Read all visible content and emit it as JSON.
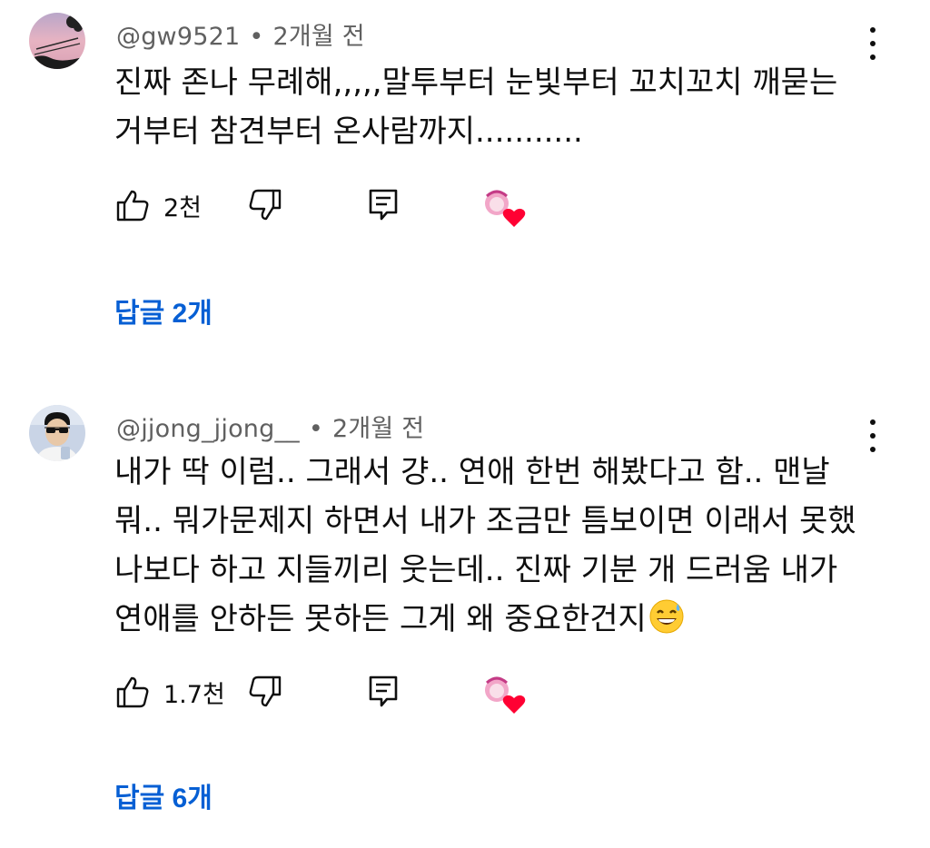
{
  "comments": [
    {
      "author": "@gw9521",
      "time": "2개월 전",
      "lines": [
        "진짜 존나 무례해,,,,,말투부터 눈빛부터  꼬치꼬치 깨묻는",
        "거부터 참견부터 온사람까지..........."
      ],
      "likes": "2천",
      "replies": "답글 2개",
      "avatar_icon": "sunset-silhouette-avatar",
      "creator_heart_icon": "creator-heart-icon"
    },
    {
      "author": "@jjong_jjong__",
      "time": "2개월 전",
      "lines": [
        "내가 딱 이럼.. 그래서 걍.. 연애 한번 해봤다고 함.. 맨날",
        "뭐.. 뭐가문제지 하면서 내가 조금만 틈보이면 이래서 못했",
        "나보다 하고 지들끼리 웃는데.. 진짜 기분 개 드러움 내가",
        "연애를 안하든 못하든 그게 왜 중요한건지"
      ],
      "trailing_emoji": "grinning-face-with-sweat-emoji",
      "likes": "1.7천",
      "replies": "답글 6개",
      "avatar_icon": "person-with-sunglasses-avatar",
      "creator_heart_icon": "creator-heart-icon"
    }
  ],
  "colors": {
    "reply_link": "#065fd4",
    "meta_text": "#606060",
    "heart": "#ff0033"
  }
}
